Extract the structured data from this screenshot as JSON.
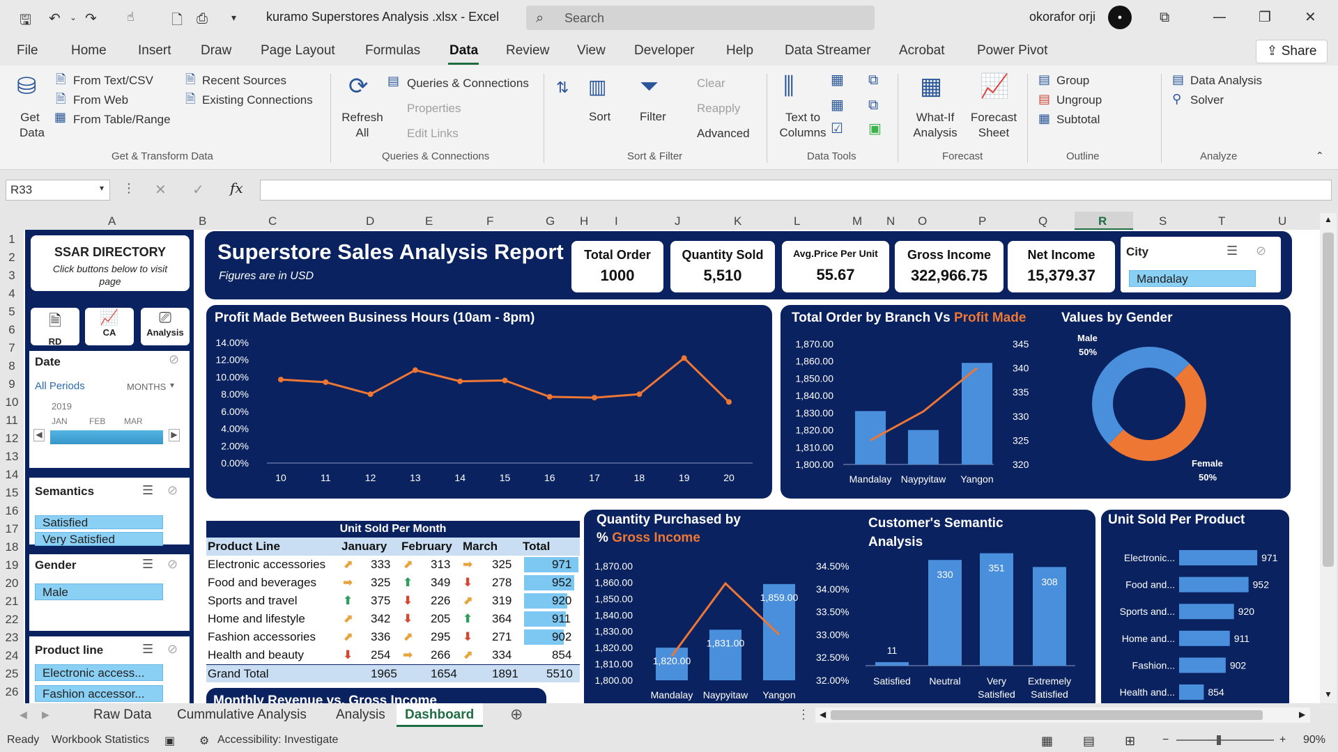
{
  "window": {
    "title": "kuramo Superstores Analysis .xlsx  -  Excel",
    "search_placeholder": "Search",
    "user": "okorafor orji",
    "share": "Share"
  },
  "menu": [
    "File",
    "Home",
    "Insert",
    "Draw",
    "Page Layout",
    "Formulas",
    "Data",
    "Review",
    "View",
    "Developer",
    "Help",
    "Data Streamer",
    "Acrobat",
    "Power Pivot"
  ],
  "ribbon": {
    "get_data": "Get Data",
    "from_text": "From Text/CSV",
    "from_web": "From Web",
    "from_table": "From Table/Range",
    "recent": "Recent Sources",
    "existing": "Existing Connections",
    "grp_get": "Get & Transform Data",
    "refresh": "Refresh All",
    "queries": "Queries & Connections",
    "properties": "Properties",
    "edit_links": "Edit Links",
    "grp_queries": "Queries & Connections",
    "sort": "Sort",
    "filter": "Filter",
    "clear": "Clear",
    "reapply": "Reapply",
    "advanced": "Advanced",
    "grp_sort": "Sort & Filter",
    "text_to_columns": "Text to Columns",
    "grp_tools": "Data Tools",
    "whatif": "What-If Analysis",
    "forecast_sheet": "Forecast Sheet",
    "grp_forecast": "Forecast",
    "group": "Group",
    "ungroup": "Ungroup",
    "subtotal": "Subtotal",
    "grp_outline": "Outline",
    "data_analysis": "Data Analysis",
    "solver": "Solver",
    "grp_analyze": "Analyze"
  },
  "formula": {
    "namebox": "R33"
  },
  "columns": [
    "A",
    "B",
    "C",
    "D",
    "E",
    "F",
    "G",
    "H",
    "I",
    "J",
    "K",
    "L",
    "M",
    "N",
    "O",
    "P",
    "Q",
    "R",
    "S",
    "T",
    "U"
  ],
  "rows": [
    "1",
    "2",
    "3",
    "4",
    "5",
    "6",
    "7",
    "8",
    "9",
    "10",
    "11",
    "12",
    "13",
    "14",
    "15",
    "16",
    "17",
    "18",
    "19",
    "20",
    "21",
    "22",
    "23",
    "24",
    "25",
    "26"
  ],
  "directory": {
    "title": "SSAR DIRECTORY",
    "subtitle": "Click buttons below to visit page",
    "btn_rd": "RD",
    "btn_ca": "CA",
    "btn_analysis": "Analysis"
  },
  "date_slicer": {
    "title": "Date",
    "all": "All Periods",
    "unit": "MONTHS",
    "year": "2019",
    "months": [
      "JAN",
      "FEB",
      "MAR"
    ]
  },
  "semantics_slicer": {
    "title": "Semantics",
    "items": [
      "Satisfied",
      "Very Satisfied"
    ]
  },
  "gender_slicer": {
    "title": "Gender",
    "items": [
      "Male"
    ]
  },
  "product_slicer": {
    "title": "Product line",
    "items": [
      "Electronic access...",
      "Fashion accessor..."
    ]
  },
  "report": {
    "title": "Superstore Sales Analysis Report",
    "subtitle": "Figures are in USD"
  },
  "kpis": [
    {
      "label": "Total Order",
      "value": "1000"
    },
    {
      "label": "Quantity Sold",
      "value": "5,510"
    },
    {
      "label": "Avg.Price Per Unit",
      "value": "55.67"
    },
    {
      "label": "Gross Income",
      "value": "322,966.75"
    },
    {
      "label": "Net Income",
      "value": "15,379.37"
    }
  ],
  "city_slicer": {
    "title": "City",
    "item": "Mandalay"
  },
  "profit_chart": {
    "title": "Profit Made Between Business Hours (10am - 8pm)"
  },
  "branch_chart": {
    "title_a": "Total Order by Branch Vs ",
    "title_b": "Profit Made"
  },
  "gender_chart": {
    "title": "Values by Gender",
    "male": "Male",
    "male_pct": "50%",
    "female": "Female",
    "female_pct": "50%"
  },
  "units_table": {
    "title": "Unit Sold Per Month",
    "headers": [
      "Product Line",
      "January",
      "February",
      "March",
      "Total"
    ],
    "rows": [
      {
        "name": "Electronic accessories",
        "jan": "333",
        "feb": "313",
        "mar": "325",
        "total": "971",
        "a1": "⬈",
        "a2": "⬈",
        "a3": "➡",
        "c1": "#e8a33a",
        "c2": "#e8a33a",
        "c3": "#e8a33a",
        "frac": 1.0
      },
      {
        "name": "Food and beverages",
        "jan": "325",
        "feb": "349",
        "mar": "278",
        "total": "952",
        "a1": "➡",
        "a2": "⬆",
        "a3": "⬇",
        "c1": "#e8a33a",
        "c2": "#2e9e5b",
        "c3": "#d9452f",
        "frac": 0.92
      },
      {
        "name": "Sports and travel",
        "jan": "375",
        "feb": "226",
        "mar": "319",
        "total": "920",
        "a1": "⬆",
        "a2": "⬇",
        "a3": "⬈",
        "c1": "#2e9e5b",
        "c2": "#d9452f",
        "c3": "#e8a33a",
        "frac": 0.8
      },
      {
        "name": "Home and lifestyle",
        "jan": "342",
        "feb": "205",
        "mar": "364",
        "total": "911",
        "a1": "⬈",
        "a2": "⬇",
        "a3": "⬆",
        "c1": "#e8a33a",
        "c2": "#d9452f",
        "c3": "#2e9e5b",
        "frac": 0.77
      },
      {
        "name": "Fashion accessories",
        "jan": "336",
        "feb": "295",
        "mar": "271",
        "total": "902",
        "a1": "⬈",
        "a2": "⬈",
        "a3": "⬇",
        "c1": "#e8a33a",
        "c2": "#e8a33a",
        "c3": "#d9452f",
        "frac": 0.73
      },
      {
        "name": "Health and beauty",
        "jan": "254",
        "feb": "266",
        "mar": "334",
        "total": "854",
        "a1": "⬇",
        "a2": "➡",
        "a3": "⬈",
        "c1": "#d9452f",
        "c2": "#e8a33a",
        "c3": "#e8a33a",
        "frac": 0
      }
    ],
    "grand": {
      "label": "Grand Total",
      "jan": "1965",
      "feb": "1654",
      "mar": "1891",
      "total": "5510"
    }
  },
  "monthly_chart": {
    "title": "Monthly Revenue vs. Gross Income"
  },
  "qty_chart": {
    "title_a": "Quantity Purchased by",
    "title_b": "% ",
    "title_c": "Gross Income"
  },
  "semantic_chart": {
    "title": "Customer's Semantic Analysis"
  },
  "product_chart": {
    "title": "Unit Sold Per Product"
  },
  "sheet_tabs": [
    "Raw Data",
    "Cummulative Analysis",
    "Analysis",
    "Dashboard"
  ],
  "status": {
    "ready": "Ready",
    "stats": "Workbook Statistics",
    "access": "Accessibility: Investigate",
    "zoom": "90%"
  },
  "colors": {
    "navy": "#0a2260",
    "orange": "#ee7733",
    "blue": "#4a8fdc",
    "excel_green": "#1f6e43"
  },
  "chart_data": [
    {
      "type": "line",
      "title": "Profit Made Between Business Hours (10am - 8pm)",
      "x": [
        "10",
        "11",
        "12",
        "13",
        "14",
        "15",
        "16",
        "17",
        "18",
        "19",
        "20"
      ],
      "values": [
        0.097,
        0.094,
        0.08,
        0.108,
        0.095,
        0.096,
        0.077,
        0.076,
        0.08,
        0.122,
        0.071
      ],
      "ylim": [
        0,
        0.14
      ],
      "yticks": [
        "0.00%",
        "2.00%",
        "4.00%",
        "6.00%",
        "8.00%",
        "10.00%",
        "12.00%",
        "14.00%"
      ]
    },
    {
      "type": "bar",
      "title": "Total Order by Branch Vs Profit Made",
      "categories": [
        "Mandalay",
        "Naypyitaw",
        "Yangon"
      ],
      "series": [
        {
          "values": [
            1831,
            1820,
            1859
          ]
        },
        {
          "values": [
            325,
            331,
            340
          ]
        }
      ],
      "ylim": [
        1800,
        1870
      ],
      "y2lim": [
        320,
        345
      ],
      "yticks": [
        "1,800.00",
        "1,810.00",
        "1,820.00",
        "1,830.00",
        "1,840.00",
        "1,850.00",
        "1,860.00",
        "1,870.00"
      ],
      "y2ticks": [
        "320",
        "325",
        "330",
        "335",
        "340",
        "345"
      ]
    },
    {
      "type": "pie",
      "title": "Values by Gender",
      "categories": [
        "Male",
        "Female"
      ],
      "values": [
        50,
        50
      ]
    },
    {
      "type": "bar",
      "title": "Quantity Purchased by % Gross Income",
      "categories": [
        "Mandalay",
        "Naypyitaw",
        "Yangon"
      ],
      "series": [
        {
          "values": [
            1820,
            1831,
            1859
          ],
          "labels": [
            "1,820.00",
            "1,831.00",
            "1,859.00"
          ]
        },
        {
          "values": [
            0.3253,
            0.3412,
            0.33
          ]
        }
      ],
      "ylim": [
        1800,
        1870
      ],
      "y2lim": [
        0.32,
        0.345
      ],
      "yticks": [
        "1,800.00",
        "1,810.00",
        "1,820.00",
        "1,830.00",
        "1,840.00",
        "1,850.00",
        "1,860.00",
        "1,870.00"
      ],
      "y2ticks": [
        "32.00%",
        "32.50%",
        "33.00%",
        "33.50%",
        "34.00%",
        "34.50%"
      ]
    },
    {
      "type": "bar",
      "title": "Customer's Semantic Analysis",
      "categories": [
        "Satisfied",
        "Neutral",
        "Very Satisfied",
        "Extremely Satisfied"
      ],
      "values": [
        11,
        330,
        351,
        308
      ],
      "ylim": [
        0,
        400
      ]
    },
    {
      "type": "bar",
      "title": "Unit Sold Per Product",
      "categories": [
        "Electronic...",
        "Food and...",
        "Sports and...",
        "Home and...",
        "Fashion...",
        "Health and..."
      ],
      "values": [
        971,
        952,
        920,
        911,
        902,
        854
      ],
      "xlim": [
        800,
        980
      ]
    }
  ]
}
